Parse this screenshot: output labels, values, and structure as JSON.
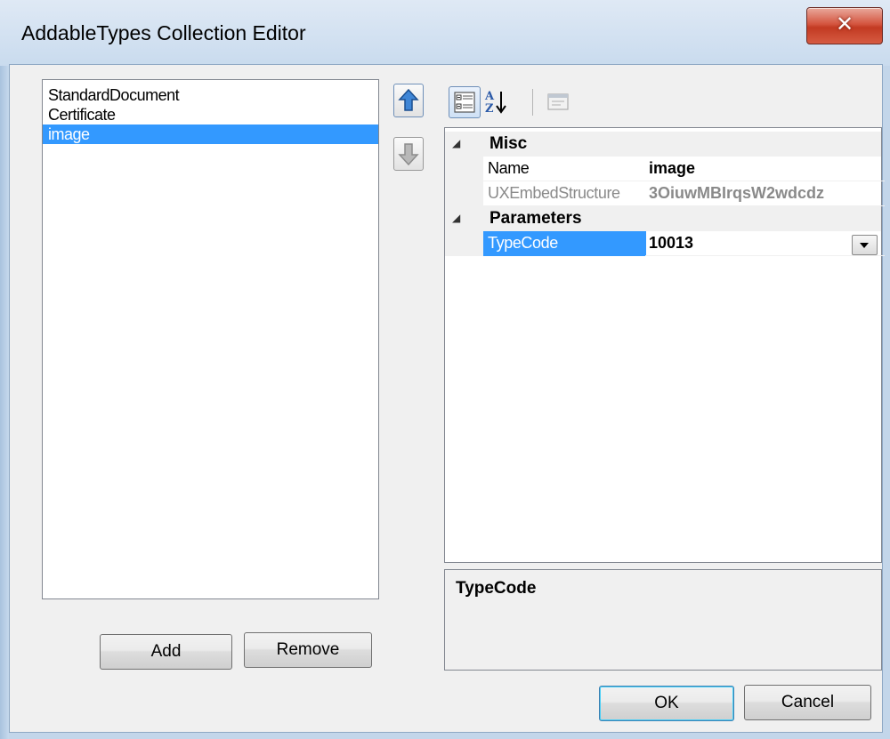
{
  "window": {
    "title": "AddableTypes Collection Editor",
    "close_icon": "close-icon"
  },
  "members": {
    "items": [
      {
        "label": "StandardDocument",
        "selected": false
      },
      {
        "label": "Certificate",
        "selected": false
      },
      {
        "label": "image",
        "selected": true
      }
    ],
    "add_label": "Add",
    "remove_label": "Remove",
    "move_up_icon": "arrow-up-icon",
    "move_down_icon": "arrow-down-icon"
  },
  "toolbar": {
    "categorized_icon": "categorized-icon",
    "alphabetical_icon": "sort-alphabetical-icon",
    "property_pages_icon": "property-pages-icon"
  },
  "properties": {
    "categories": [
      {
        "label": "Misc",
        "rows": [
          {
            "name": "Name",
            "value": "image",
            "readonly": false
          },
          {
            "name": "UXEmbedStructure",
            "value": "3OiuwMBIrqsW2wdcdz",
            "readonly": true
          }
        ]
      },
      {
        "label": "Parameters",
        "rows": [
          {
            "name": "TypeCode",
            "value": "10013",
            "readonly": false,
            "selected": true
          }
        ]
      }
    ]
  },
  "description": {
    "title": "TypeCode",
    "text": ""
  },
  "dialog_buttons": {
    "ok_label": "OK",
    "cancel_label": "Cancel"
  },
  "colors": {
    "selection": "#3399ff",
    "accent_blue": "#1c6fc8"
  }
}
